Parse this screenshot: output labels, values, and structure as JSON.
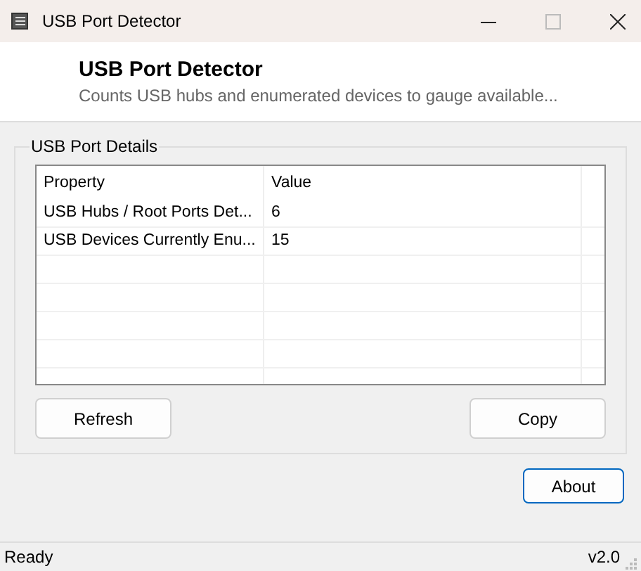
{
  "window": {
    "title": "USB Port Detector"
  },
  "header": {
    "title": "USB Port Detector",
    "subtitle": "Counts USB hubs and enumerated devices to gauge available..."
  },
  "group": {
    "title": "USB Port Details",
    "table": {
      "columns": [
        "Property",
        "Value"
      ],
      "rows": [
        [
          "USB Hubs / Root Ports Det...",
          "6"
        ],
        [
          "USB Devices Currently Enu...",
          "15"
        ]
      ]
    },
    "buttons": [
      "Refresh",
      "Copy"
    ]
  },
  "about_button": "About",
  "status_bar": {
    "text": "Ready",
    "version": "v2.0"
  }
}
